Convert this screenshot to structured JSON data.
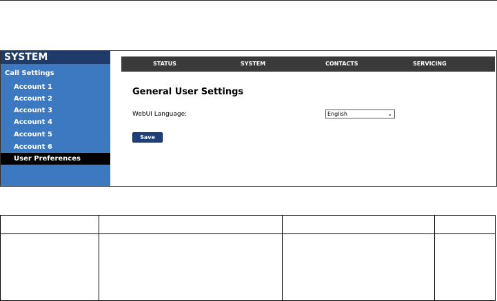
{
  "sidebar": {
    "title": "SYSTEM",
    "section": "Call Settings",
    "items": [
      {
        "label": "Account 1"
      },
      {
        "label": "Account 2"
      },
      {
        "label": "Account 3"
      },
      {
        "label": "Account 4"
      },
      {
        "label": "Account 5"
      },
      {
        "label": "Account 6"
      },
      {
        "label": "User Preferences",
        "active": true
      }
    ]
  },
  "nav": {
    "tabs": [
      {
        "label": "STATUS"
      },
      {
        "label": "SYSTEM"
      },
      {
        "label": "CONTACTS"
      },
      {
        "label": "SERVICING"
      }
    ]
  },
  "main": {
    "heading": "General User Settings",
    "language_label": "WebUI Language:",
    "language_value": "English",
    "save_label": "Save"
  },
  "colors": {
    "sidebar_bg": "#3d79c1",
    "sidebar_title_bg": "#1e3b6a",
    "nav_bg": "#3a3a3a",
    "button_bg": "#1f3f7a"
  }
}
